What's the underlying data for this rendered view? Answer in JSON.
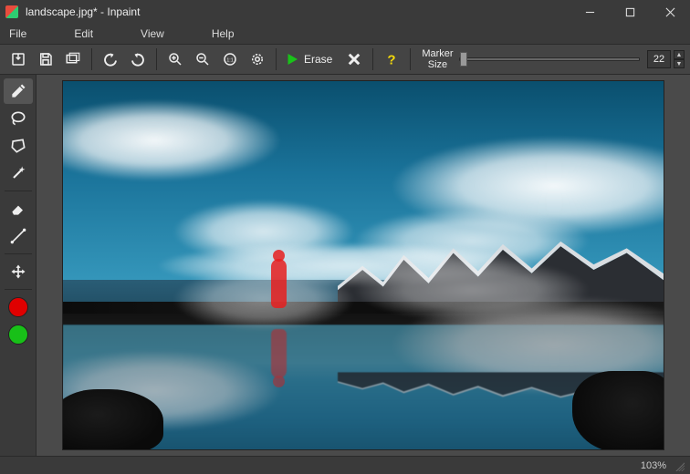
{
  "window": {
    "title": "landscape.jpg* - Inpaint"
  },
  "menu": {
    "file": "File",
    "edit": "Edit",
    "view": "View",
    "help": "Help"
  },
  "toolbar": {
    "erase_label": "Erase",
    "marker_label": "Marker\nSize",
    "marker_value": "22"
  },
  "sidebar": {
    "colors": {
      "red": "#e00000",
      "green": "#18c018"
    }
  },
  "status": {
    "zoom": "103%"
  }
}
